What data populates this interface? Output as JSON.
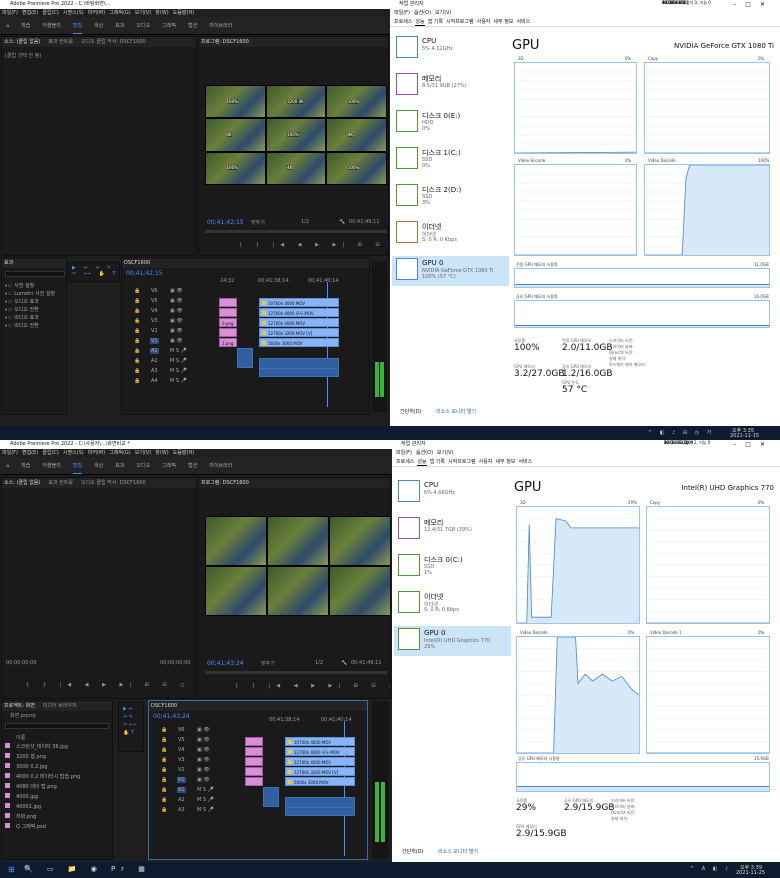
{
  "top": {
    "premiere": {
      "title": "Adobe Premiere Pro 2022 - C:\\바탕화면\\...",
      "menu": [
        "파일(F)",
        "편집(E)",
        "클립(C)",
        "시퀀스(S)",
        "마커(M)",
        "그래픽(G)",
        "보기(V)",
        "창(W)",
        "도움말(H)"
      ],
      "workspaces": [
        "학습",
        "어셈블리",
        "편집",
        "색상",
        "효과",
        "오디오",
        "그래픽",
        "캡션",
        "라이브러리"
      ],
      "active_workspace": "편집",
      "source_tabs": [
        "소스: (클립 없음)",
        "효과 컨트롤",
        "오디오 클립 믹서: DSCF1600"
      ],
      "source_empty": "(클립 선택 안 됨)",
      "program_tab": "프로그램: DSCF1600",
      "program_timecode": "00;41;42;15",
      "program_fit": "맞추기",
      "program_quality": "1/2",
      "program_duration": "00;41;49;11",
      "video_labels": [
        "100%",
        "3200 4K",
        "100%",
        "4K",
        "100%",
        "4K",
        "100%",
        "4K",
        "100%",
        "4K",
        "4K",
        "4K"
      ],
      "effects_tab": "효과",
      "effects_items": [
        "사전 설정",
        "Lumetri 사전 설정",
        "오디오 효과",
        "오디오 전환",
        "비디오 효과",
        "비디오 전환"
      ],
      "timeline_tab": "DSCF1600",
      "timeline_timecode": "00;41;42;15",
      "ruler_marks": [
        "24;32",
        "00;41;38;14",
        "00;41;40;14"
      ],
      "tracks_v": [
        "V6",
        "V5",
        "V4",
        "V3",
        "V2",
        "V1"
      ],
      "tracks_a": [
        "A1",
        "A2",
        "A3",
        "A4"
      ],
      "clips": [
        "10700k 4000.MOV",
        "12700k 4000 모두.MOV",
        "12700k 4000.MOV",
        "12700k 3200.MOV [V]",
        "5600x 3000.MOV"
      ],
      "pclip_labels": [
        "",
        "",
        "0.png",
        "",
        "2.png"
      ]
    },
    "taskmgr": {
      "title": "작업 관리자",
      "menu": [
        "파일(F)",
        "옵션(O)",
        "보기(V)"
      ],
      "tabs": [
        "프로세스",
        "성능",
        "앱 기록",
        "시작프로그램",
        "사용자",
        "세부 정보",
        "서비스"
      ],
      "active_tab": "성능",
      "sidebar": [
        {
          "name": "CPU",
          "line1": "5% 4.12GHz",
          "line2": ""
        },
        {
          "name": "메모리",
          "line1": "8.5/31.9GB (27%)",
          "line2": ""
        },
        {
          "name": "디스크 0(E:)",
          "line1": "HDD",
          "line2": "0%"
        },
        {
          "name": "디스크 1(C:)",
          "line1": "SSD",
          "line2": "0%"
        },
        {
          "name": "디스크 2(D:)",
          "line1": "SSD",
          "line2": "3%"
        },
        {
          "name": "이더넷",
          "line1": "이더넷",
          "line2": "S: 0 R: 0 Kbps"
        },
        {
          "name": "GPU 0",
          "line1": "NVIDIA GeForce GTX 1080 Ti",
          "line2": "100% (57 °C)"
        }
      ],
      "gpu_heading": "GPU",
      "gpu_name": "NVIDIA GeForce GTX 1080 Ti",
      "graphs": [
        {
          "label": "3D",
          "pct": "0%"
        },
        {
          "label": "Copy",
          "pct": "0%"
        },
        {
          "label": "Video Encode",
          "pct": "0%"
        },
        {
          "label": "Video Decode",
          "pct": "100%"
        }
      ],
      "dedicated_label": "전용 GPU 메모리 사용량",
      "dedicated_max": "11.0GB",
      "shared_label": "공유 GPU 메모리 사용량",
      "shared_max": "16.0GB",
      "stats": [
        {
          "label": "사용률",
          "value": "100%"
        },
        {
          "label": "전용 GPU 메모리",
          "value": "2.0/11.0GB"
        },
        {
          "label": "GPU 메모리",
          "value": "3.2/27.0GB"
        },
        {
          "label": "공유 GPU 메모리",
          "value": "1.2/16.0GB"
        },
        {
          "label": "GPU 온도",
          "value": "57 °C"
        }
      ],
      "info_labels": [
        "드라이버 버전:",
        "드라이버 날짜:",
        "DirectX 버전:",
        "실제 위치:",
        "하드웨어 예약 메모리:"
      ],
      "info_values": [
        "30.0.14.9661",
        "2021-10-28",
        "12 (FL 12.1)",
        "PCI 버스 45, 장치 0, 기능 0",
        "137MB"
      ],
      "footer_brief": "간단히(D)",
      "footer_monitor": "리소스 모니터 열기"
    },
    "taskbar_time": "오후 3:35",
    "taskbar_date": "2021-11-15"
  },
  "bottom": {
    "premiere": {
      "title": "Adobe Premiere Pro 2022 - C:\\사용자\\...\\화면비교 *",
      "taskbar_tabs": [
        "Adobe Premiere Pr...",
        "작업 관리자"
      ],
      "menu": [
        "파일(F)",
        "편집(E)",
        "클립(C)",
        "시퀀스(S)",
        "마커(M)",
        "그래픽(G)",
        "보기(V)",
        "창(W)",
        "도움말(H)"
      ],
      "workspaces": [
        "학습",
        "어셈블리",
        "편집",
        "색상",
        "효과",
        "오디오",
        "그래픽",
        "캡션",
        "라이브러리"
      ],
      "active_workspace": "편집",
      "source_tabs": [
        "소스: (클립 없음)",
        "효과 컨트롤",
        "오디오 클립 믹서: DSCF1600"
      ],
      "program_tab": "프로그램: DSCF1600",
      "source_tc_left": "00;00;00;00",
      "source_tc_right": "00;00;00;00",
      "program_timecode": "00;41;43;24",
      "program_fit": "맞추기",
      "program_quality": "1/2",
      "program_duration": "00;41;49;11",
      "project_tab": "프로젝트: 화면",
      "media_tab": "미디어 브라우저",
      "project_file": "화면.prproj",
      "project_header": "이름",
      "project_items": [
        "스크린샷_데이터 36.jpg",
        "3200 잡.png",
        "3000 0.2.jpg",
        "4000 0.2 데이터시 탑습.png",
        "4080 데이 탑.png",
        "4000.jpg",
        "40001.jpg",
        "저화.png",
        "Q 그래픽.psd"
      ],
      "timeline_tab": "DSCF1600",
      "timeline_timecode": "00;41;43;24",
      "ruler_marks": [
        "00;41;38;14",
        "00;41;40;14"
      ],
      "tracks_v": [
        "V6",
        "V5",
        "V4",
        "V3",
        "V2",
        "V1"
      ],
      "tracks_a": [
        "A1",
        "A2",
        "A3"
      ],
      "clips": [
        "10700k 4000.MOV",
        "12700k 4000 모두.MOV",
        "12700k 4000.MOV",
        "12700k 3200.MOV [V]",
        "5600x 3000.MOV"
      ]
    },
    "taskmgr": {
      "title": "작업 관리자",
      "menu": [
        "파일(F)",
        "옵션(O)",
        "보기(V)"
      ],
      "tabs": [
        "프로세스",
        "성능",
        "앱 기록",
        "시작프로그램",
        "사용자",
        "세부 정보",
        "서비스"
      ],
      "active_tab": "성능",
      "sidebar": [
        {
          "name": "CPU",
          "line1": "6% 4.66GHz",
          "line2": ""
        },
        {
          "name": "메모리",
          "line1": "12.4/31.7GB (39%)",
          "line2": ""
        },
        {
          "name": "디스크 0(C:)",
          "line1": "SSD",
          "line2": "1%"
        },
        {
          "name": "이더넷",
          "line1": "이더넷",
          "line2": "S: 0 R: 0 Kbps"
        },
        {
          "name": "GPU 0",
          "line1": "Intel(R) UHD Graphics 770",
          "line2": "29%"
        }
      ],
      "gpu_heading": "GPU",
      "gpu_name": "Intel(R) UHD Graphics 770",
      "graphs": [
        {
          "label": "3D",
          "pct": "29%"
        },
        {
          "label": "Copy",
          "pct": "0%"
        },
        {
          "label": "Video Decode",
          "pct": "0%"
        },
        {
          "label": "Video Decode 1",
          "pct": "0%"
        }
      ],
      "shared_label": "공유 GPU 메모리 사용량",
      "shared_max": "15.9GB",
      "stats": [
        {
          "label": "사용률",
          "value": "29%"
        },
        {
          "label": "공유 GPU 메모리",
          "value": "2.9/15.9GB"
        },
        {
          "label": "GPU 메모리",
          "value": "2.9/15.9GB"
        }
      ],
      "info_labels": [
        "드라이버 버전:",
        "드라이버 날짜:",
        "DirectX 버전:",
        "실제 위치:"
      ],
      "info_values": [
        "30.0.101.1069",
        "2021-11-02",
        "12 (FL 12.1)",
        "PCI 버스 0, 장치 2, 기능 0"
      ],
      "footer_brief": "간단히(D)",
      "footer_monitor": "리소스 모니터 열기"
    },
    "taskbar_time": "오후 3:39",
    "taskbar_date": "2021-11-25"
  },
  "colors": {
    "accent": "#4b8fff",
    "clip_video": "#8ab4f8",
    "clip_pink": "#d88fd8",
    "graph_line": "#4a86c8",
    "graph_fill": "#d7e8f7"
  }
}
